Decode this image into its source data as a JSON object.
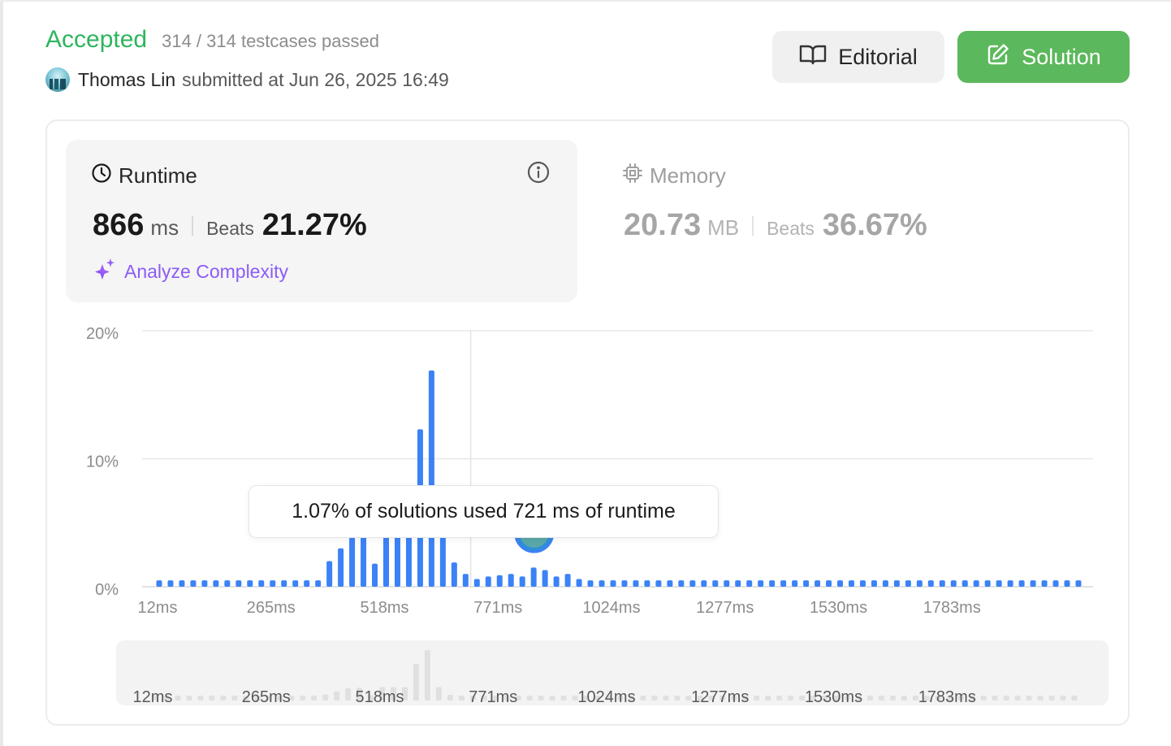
{
  "submission": {
    "status": "Accepted",
    "testcases": "314 / 314 testcases passed",
    "user": "Thomas Lin",
    "submitted_at": "submitted at Jun 26, 2025 16:49"
  },
  "buttons": {
    "editorial_label": "Editorial",
    "solution_label": "Solution"
  },
  "runtime": {
    "title": "Runtime",
    "value": "866",
    "unit": "ms",
    "beats_label": "Beats",
    "beats_value": "21.27%",
    "analyze_label": "Analyze Complexity"
  },
  "memory": {
    "title": "Memory",
    "value": "20.73",
    "unit": "MB",
    "beats_label": "Beats",
    "beats_value": "36.67%"
  },
  "tooltip": {
    "text": "1.07% of solutions used 721 ms of runtime"
  },
  "colors": {
    "accepted": "#2db55d",
    "solution_button": "#5cb85c",
    "bar": "#3b82f6",
    "analyze": "#8b5cf6",
    "minimap_bar": "#e0e0e0"
  },
  "icons": {
    "editorial": "book-open-icon",
    "solution": "edit-icon",
    "runtime": "clock-icon",
    "memory": "chip-icon",
    "info": "info-icon",
    "analyze": "sparkles-icon"
  },
  "chart_data": {
    "type": "bar",
    "title": "",
    "xlabel": "",
    "ylabel": "",
    "ylim": [
      0,
      20
    ],
    "y_ticks": [
      "20%",
      "10%",
      "0%"
    ],
    "x_ticks": [
      "12ms",
      "265ms",
      "518ms",
      "771ms",
      "1024ms",
      "1277ms",
      "1530ms",
      "1783ms"
    ],
    "grid": true,
    "legend": "none",
    "user_runtime_ms": 866,
    "highlighted": {
      "runtime_ms": 721,
      "percent": 1.07
    },
    "bin_start_ms": 12,
    "bin_width_ms": 25.3,
    "values": [
      0.5,
      0.5,
      0.5,
      0.5,
      0.5,
      0.5,
      0.5,
      0.5,
      0.5,
      0.5,
      0.5,
      0.5,
      0.5,
      0.5,
      0.5,
      2.0,
      3.0,
      4.1,
      4.3,
      1.8,
      4.5,
      4.5,
      4.5,
      12.3,
      16.9,
      4.5,
      1.9,
      1.0,
      0.6,
      0.8,
      0.9,
      1.0,
      0.8,
      1.5,
      1.3,
      0.8,
      1.0,
      0.6,
      0.5,
      0.5,
      0.5,
      0.5,
      0.5,
      0.5,
      0.5,
      0.5,
      0.5,
      0.5,
      0.5,
      0.5,
      0.5,
      0.5,
      0.5,
      0.5,
      0.5,
      0.5,
      0.5,
      0.5,
      0.5,
      0.5,
      0.5,
      0.5,
      0.5,
      0.5,
      0.5,
      0.5,
      0.5,
      0.5,
      0.5,
      0.5,
      0.5,
      0.5,
      0.5,
      0.5,
      0.5,
      0.5,
      0.5,
      0.5,
      0.5,
      0.5,
      0.5,
      0.5
    ]
  }
}
